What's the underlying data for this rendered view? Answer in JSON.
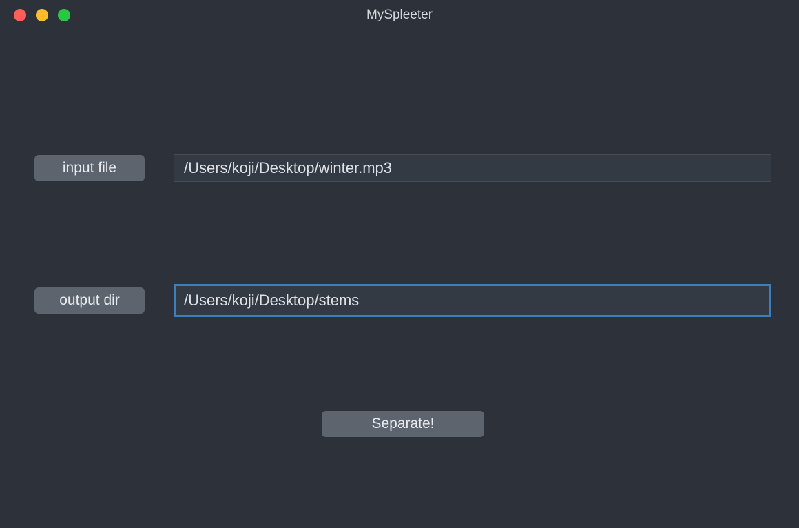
{
  "window": {
    "title": "MySpleeter"
  },
  "form": {
    "input_file": {
      "label": "input file",
      "value": "/Users/koji/Desktop/winter.mp3"
    },
    "output_dir": {
      "label": "output dir",
      "value": "/Users/koji/Desktop/stems"
    },
    "separate_button_label": "Separate!"
  }
}
